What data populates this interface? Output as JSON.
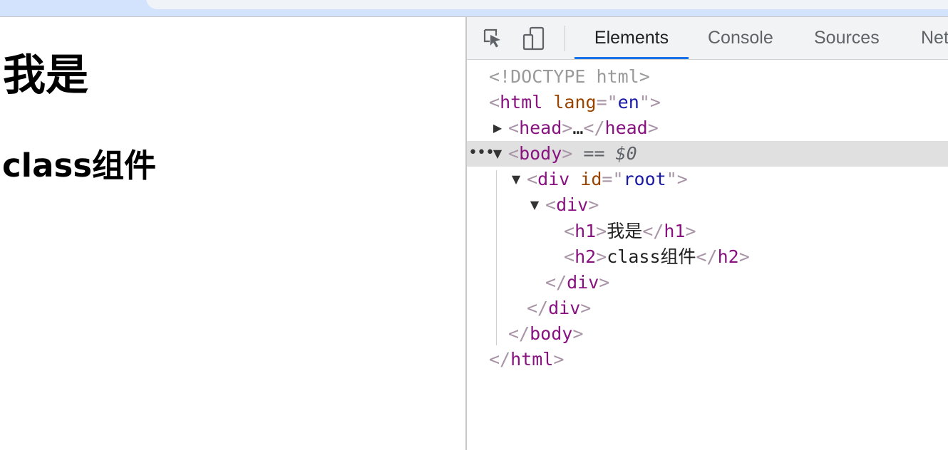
{
  "page": {
    "h1": "我是",
    "h2": "class组件"
  },
  "devtools": {
    "toolbar": {
      "inspect_icon": "inspect-element-icon",
      "device_icon": "device-toolbar-icon"
    },
    "tabs": [
      {
        "label": "Elements",
        "active": true
      },
      {
        "label": "Console",
        "active": false
      },
      {
        "label": "Sources",
        "active": false
      },
      {
        "label": "Net",
        "active": false
      }
    ],
    "accent_color": "#1a73e8",
    "dom": {
      "doctype": "<!DOCTYPE html>",
      "html_tag": "html",
      "lang_attr": "lang",
      "lang_value": "en",
      "head_tag": "head",
      "ellipsis": "…",
      "body_tag": "body",
      "selected_marker": "== $0",
      "div_tag": "div",
      "id_attr": "id",
      "id_value": "root",
      "h1_tag": "h1",
      "h1_text": "我是",
      "h2_tag": "h2",
      "h2_text": "class组件"
    }
  }
}
